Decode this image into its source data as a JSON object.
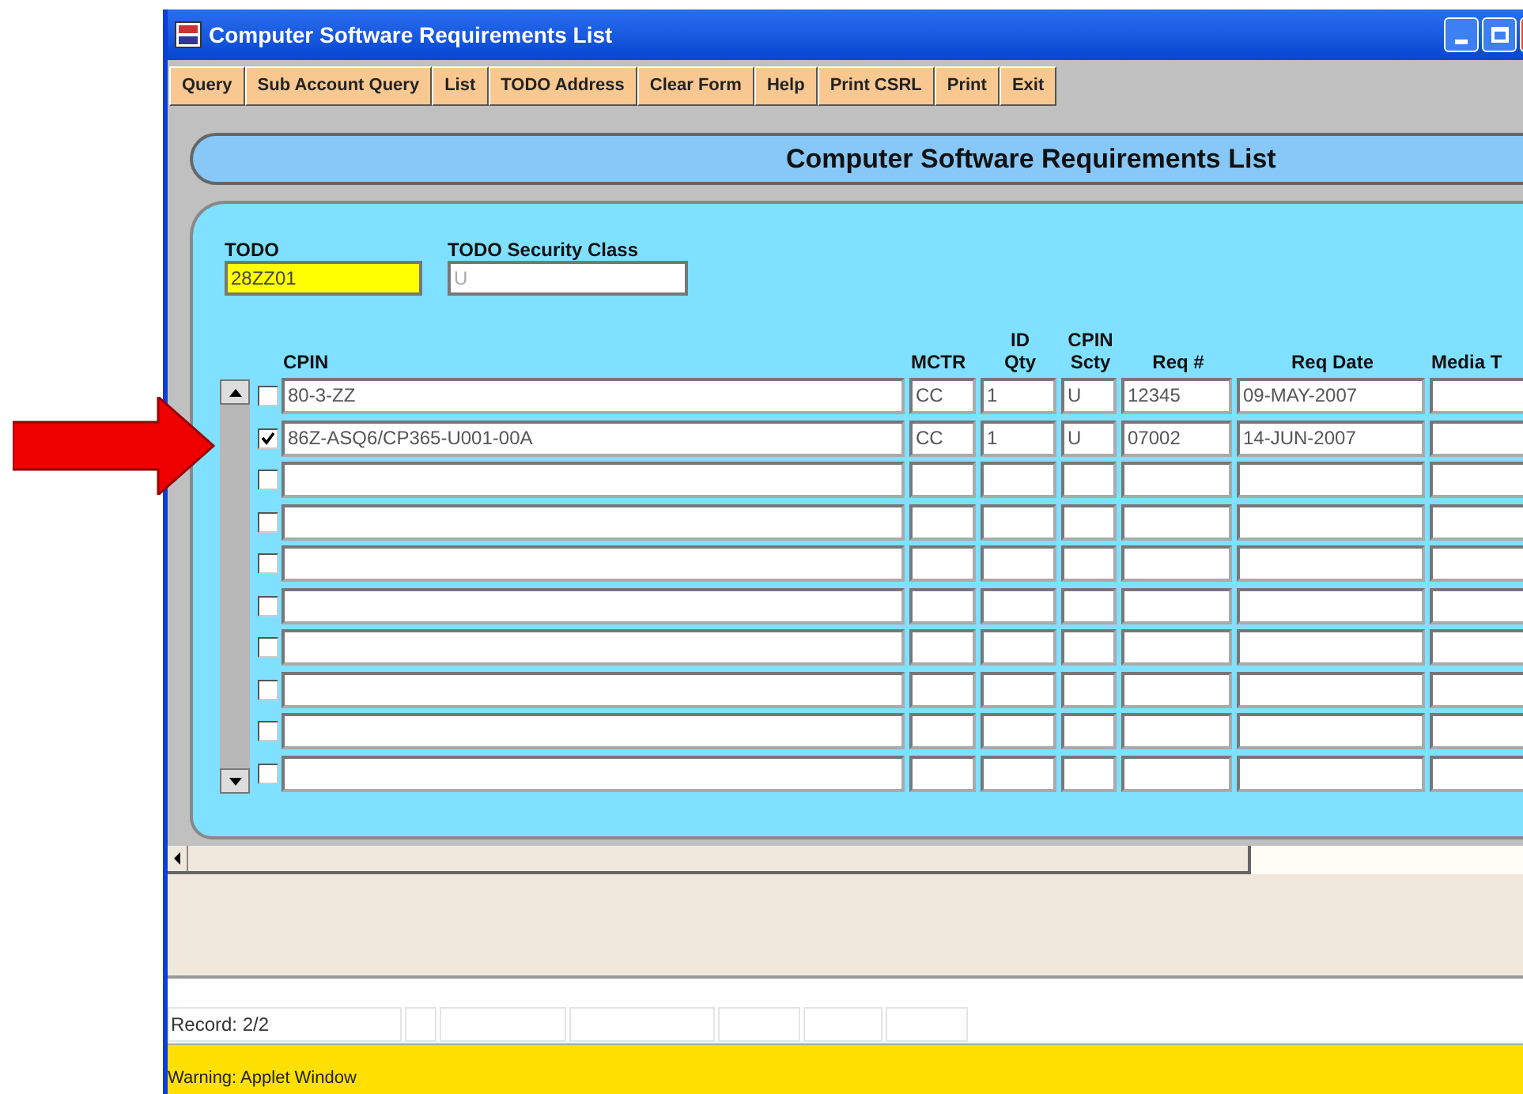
{
  "window": {
    "title": "Computer Software Requirements List"
  },
  "toolbar": [
    "Query",
    "Sub Account Query",
    "List",
    "TODO Address",
    "Clear Form",
    "Help",
    "Print CSRL",
    "Print",
    "Exit"
  ],
  "header": {
    "title": "Computer Software Requirements List"
  },
  "todo": {
    "label": "TODO",
    "value": "28ZZ01"
  },
  "security_class": {
    "label": "TODO Security Class",
    "value": "U",
    "disabled": true
  },
  "columns": [
    {
      "lines": [
        "CPIN"
      ]
    },
    {
      "lines": [
        "MCTR"
      ]
    },
    {
      "lines": [
        "ID",
        "Qty"
      ]
    },
    {
      "lines": [
        "CPIN",
        "Scty"
      ]
    },
    {
      "lines": [
        "Req #"
      ]
    },
    {
      "lines": [
        "Req Date"
      ]
    },
    {
      "lines": [
        "Media T"
      ]
    }
  ],
  "rows": [
    {
      "checked": false,
      "cells": [
        "80-3-ZZ",
        "CC",
        "1",
        "U",
        "12345",
        "09-MAY-2007"
      ]
    },
    {
      "checked": true,
      "cells": [
        "86Z-ASQ6/CP365-U001-00A",
        "CC",
        "1",
        "U",
        "07002",
        "14-JUN-2007"
      ]
    },
    {
      "checked": false
    },
    {
      "checked": false
    },
    {
      "checked": false
    },
    {
      "checked": false
    },
    {
      "checked": false
    },
    {
      "checked": false
    },
    {
      "checked": false
    },
    {
      "checked": false
    }
  ],
  "status_bar": {
    "record": "Record: 2/2"
  },
  "warning": "Warning: Applet Window"
}
